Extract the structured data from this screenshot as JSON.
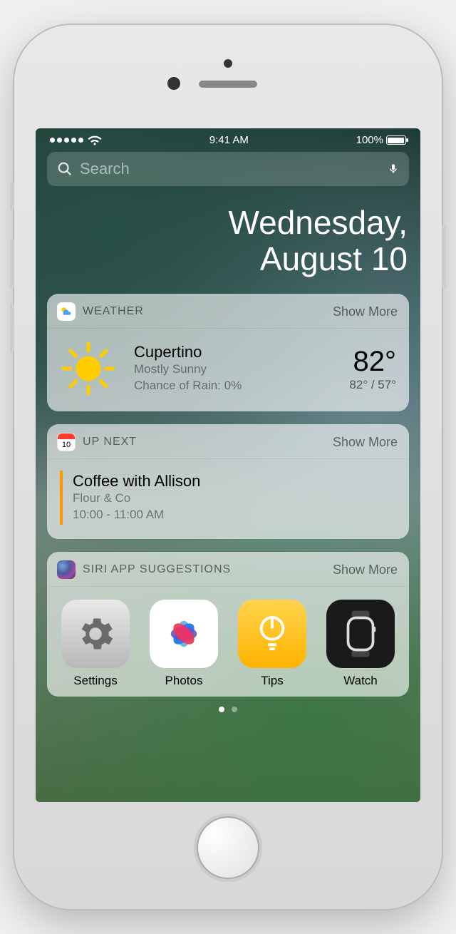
{
  "status": {
    "time": "9:41 AM",
    "battery_pct": "100%"
  },
  "search": {
    "placeholder": "Search"
  },
  "date": {
    "line1": "Wednesday,",
    "line2": "August 10"
  },
  "show_more_label": "Show More",
  "weather": {
    "title": "WEATHER",
    "location": "Cupertino",
    "condition": "Mostly Sunny",
    "rain": "Chance of Rain: 0%",
    "temp": "82°",
    "range": "82° / 57°"
  },
  "upnext": {
    "title": "UP NEXT",
    "icon_day": "10",
    "event_title": "Coffee with Allison",
    "event_location": "Flour & Co",
    "event_time": "10:00 - 11:00 AM"
  },
  "siri": {
    "title": "SIRI APP SUGGESTIONS",
    "apps": {
      "settings": "Settings",
      "photos": "Photos",
      "tips": "Tips",
      "watch": "Watch"
    }
  }
}
